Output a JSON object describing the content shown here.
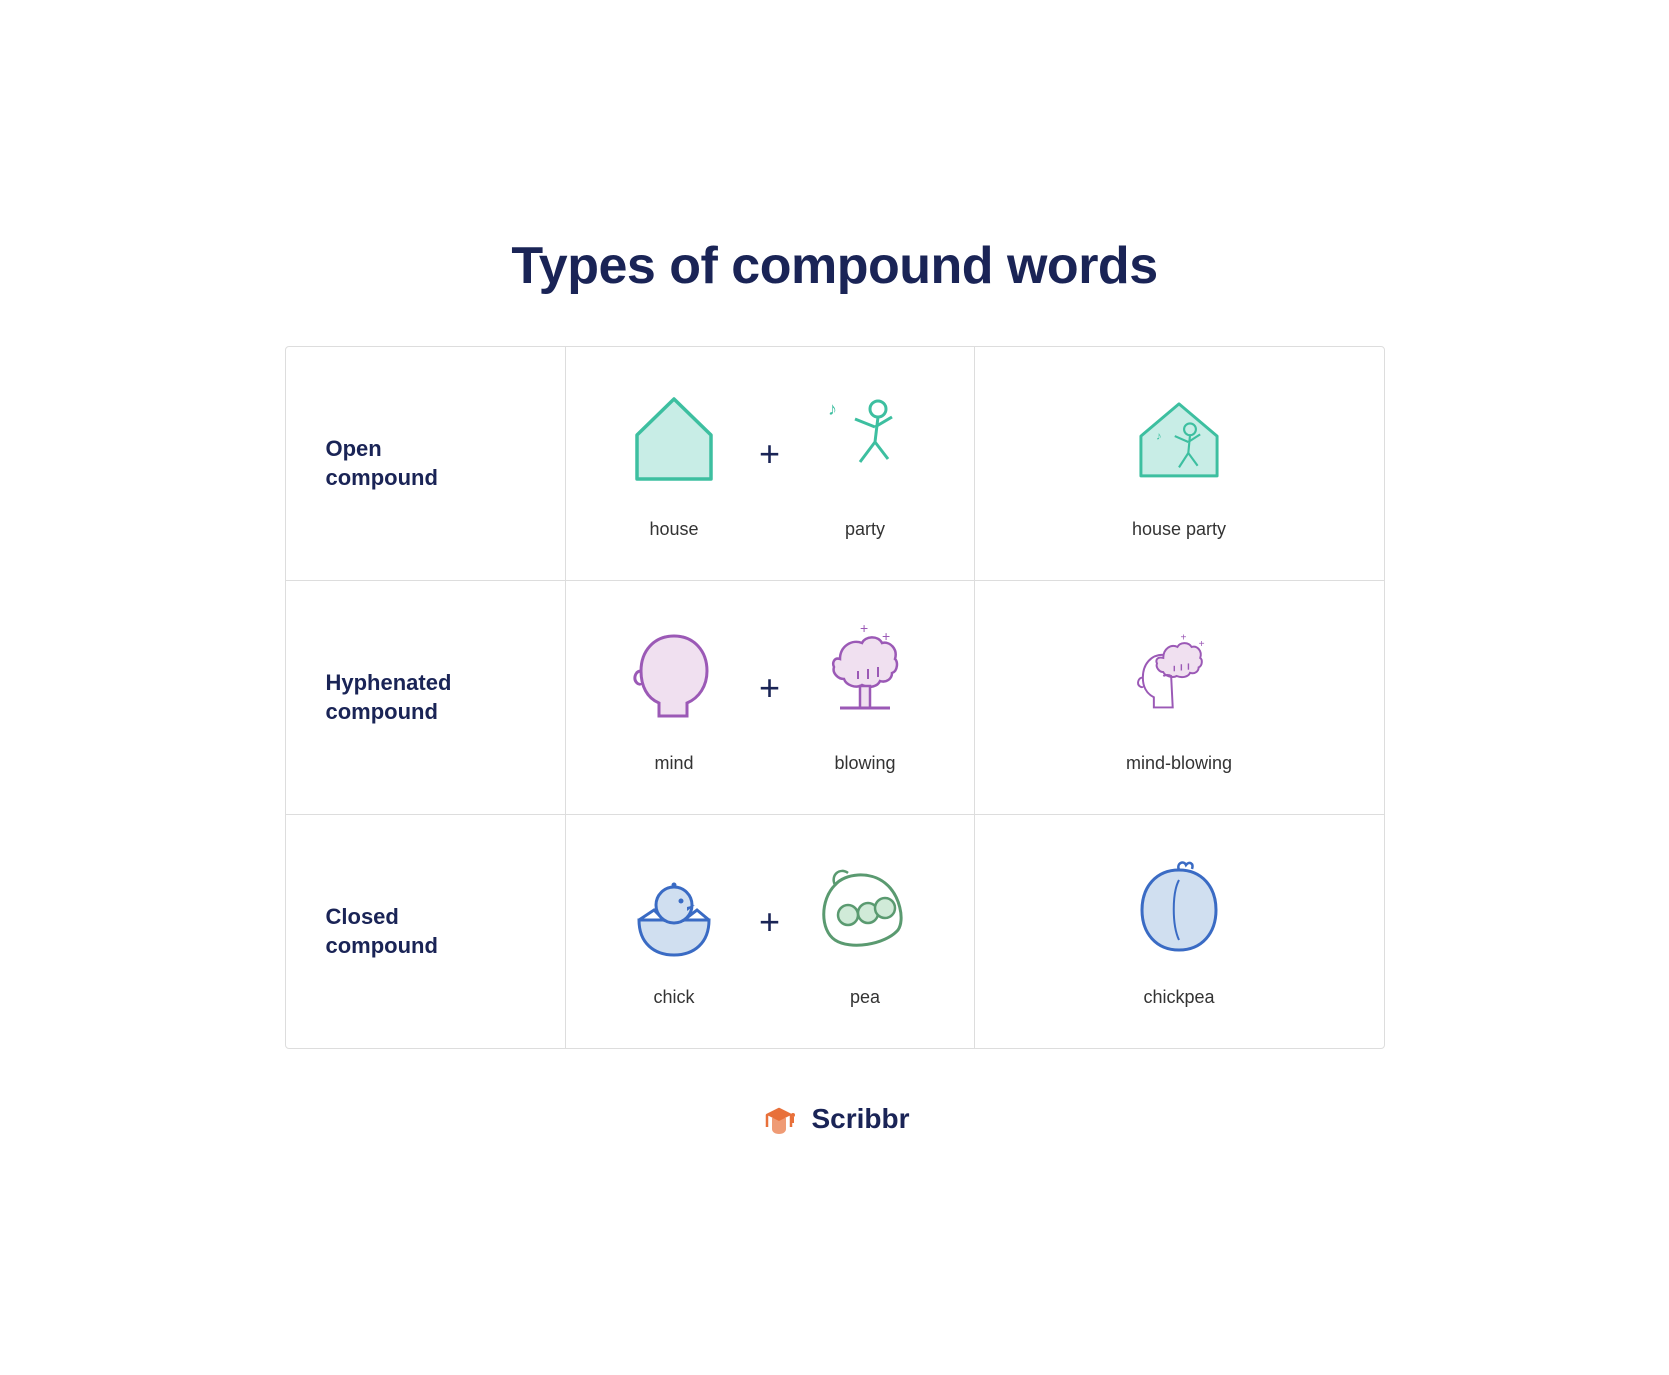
{
  "page": {
    "title": "Types of compound words"
  },
  "rows": [
    {
      "type": "Open\ncompound",
      "word1": "house",
      "word2": "party",
      "combined": "house party"
    },
    {
      "type": "Hyphenated\ncompound",
      "word1": "mind",
      "word2": "blowing",
      "combined": "mind-blowing"
    },
    {
      "type": "Closed\ncompound",
      "word1": "chick",
      "word2": "pea",
      "combined": "chickpea"
    }
  ],
  "footer": {
    "brand": "Scribbr"
  }
}
